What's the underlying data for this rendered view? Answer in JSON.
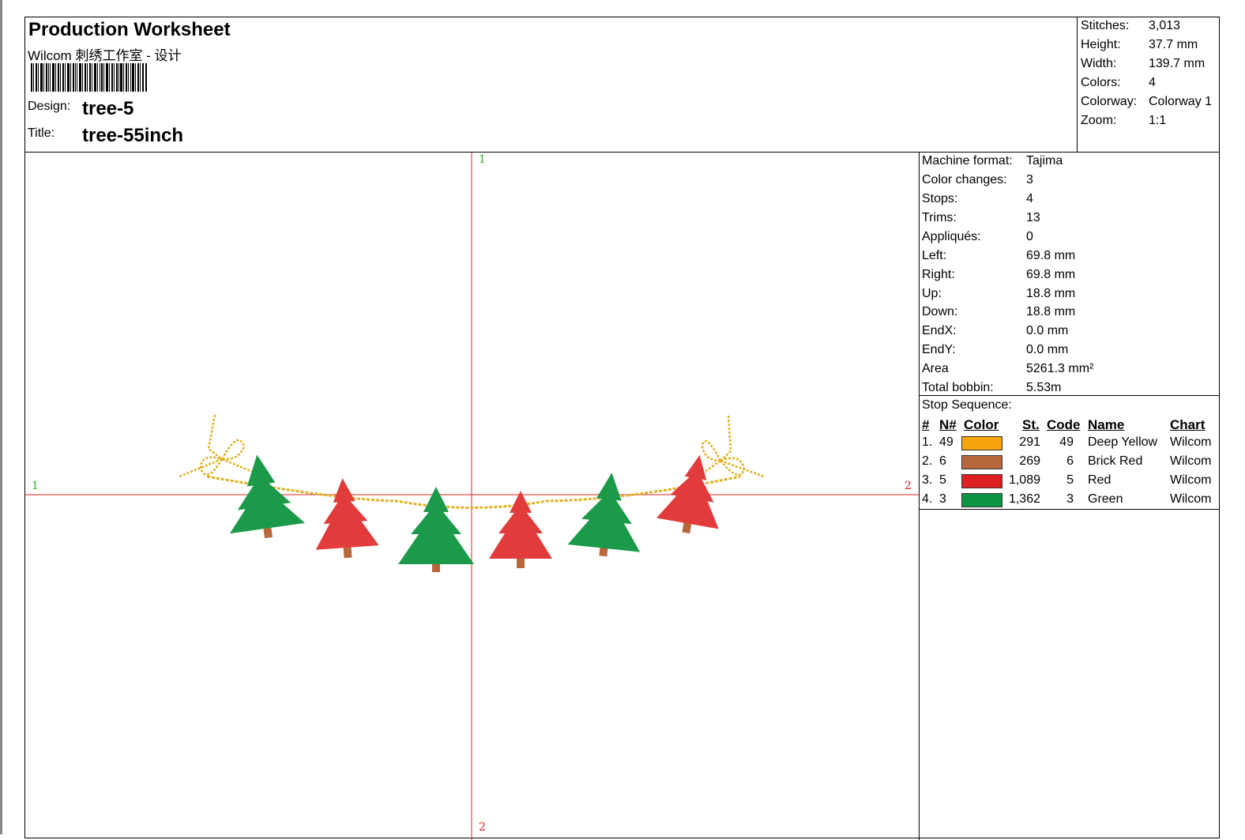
{
  "header": {
    "title": "Production Worksheet",
    "subtitle": "Wilcom 刺绣工作室 - 设计",
    "design_label": "Design:",
    "design_value": "tree-5",
    "title_label": "Title:",
    "title_value": "tree-55inch"
  },
  "summary": [
    {
      "label": "Stitches:",
      "value": "3,013"
    },
    {
      "label": "Height:",
      "value": "37.7 mm"
    },
    {
      "label": "Width:",
      "value": "139.7 mm"
    },
    {
      "label": "Colors:",
      "value": "4"
    },
    {
      "label": "Colorway:",
      "value": "Colorway 1"
    },
    {
      "label": "Zoom:",
      "value": "1:1"
    }
  ],
  "stats": [
    {
      "label": "Machine format:",
      "value": "Tajima"
    },
    {
      "label": "Color changes:",
      "value": "3"
    },
    {
      "label": "Stops:",
      "value": "4"
    },
    {
      "label": "Trims:",
      "value": "13"
    },
    {
      "label": "Appliqués:",
      "value": "0"
    },
    {
      "label": "Left:",
      "value": "69.8 mm"
    },
    {
      "label": "Right:",
      "value": "69.8 mm"
    },
    {
      "label": "Up:",
      "value": "18.8 mm"
    },
    {
      "label": "Down:",
      "value": "18.8 mm"
    },
    {
      "label": "EndX:",
      "value": "0.0 mm"
    },
    {
      "label": "EndY:",
      "value": "0.0 mm"
    },
    {
      "label": "Area",
      "value": "5261.3 mm²"
    },
    {
      "label": "Total bobbin:",
      "value": "5.53m"
    }
  ],
  "stop_sequence": {
    "title": "Stop Sequence:",
    "headers": {
      "num": "#",
      "n": "N#",
      "color": "Color",
      "st": "St.",
      "code": "Code",
      "name": "Name",
      "chart": "Chart"
    },
    "rows": [
      {
        "num": "1.",
        "n": "49",
        "color": "#f7a40c",
        "st": "291",
        "code": "49",
        "name": "Deep Yellow",
        "chart": "Wilcom"
      },
      {
        "num": "2.",
        "n": "6",
        "color": "#b8683c",
        "st": "269",
        "code": "6",
        "name": "Brick Red",
        "chart": "Wilcom"
      },
      {
        "num": "3.",
        "n": "5",
        "color": "#dd1f22",
        "st": "1,089",
        "code": "5",
        "name": "Red",
        "chart": "Wilcom"
      },
      {
        "num": "4.",
        "n": "3",
        "color": "#0c9444",
        "st": "1,362",
        "code": "3",
        "name": "Green",
        "chart": "Wilcom"
      }
    ]
  },
  "axis_markers": {
    "top": "1",
    "bottom": "2",
    "left": "1",
    "right": "2"
  },
  "colors": {
    "axis": "#e02020",
    "marker_green": "#22bb22",
    "marker_red": "#d02020",
    "tree_green": "#1b9a4a",
    "tree_red": "#e23b3b",
    "trunk": "#b8683c",
    "cord": "#e0b020"
  },
  "design_elements": [
    "tree-green",
    "tree-red",
    "tree-green",
    "tree-red",
    "tree-green",
    "tree-red"
  ]
}
